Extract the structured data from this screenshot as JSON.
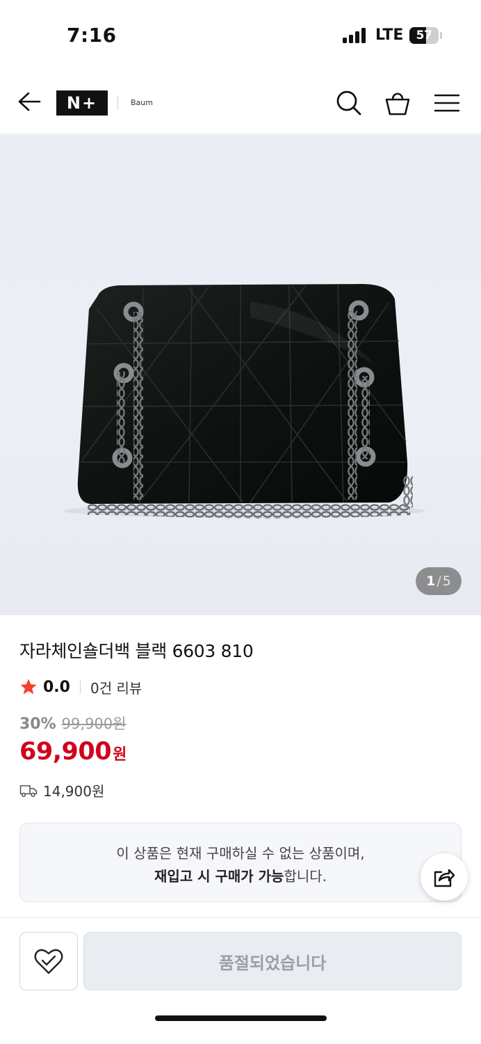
{
  "status_bar": {
    "time": "7:16",
    "network": "LTE",
    "battery_level": "57",
    "battery_fraction": 0.57
  },
  "header": {
    "back_icon": "arrow-left-icon",
    "logo_text": "N+",
    "brand_subtitle": "Baum",
    "search_icon": "search-icon",
    "bag_icon": "shopping-bag-icon",
    "menu_icon": "hamburger-menu-icon"
  },
  "gallery": {
    "current": "1",
    "separator": "/",
    "total": "5"
  },
  "product": {
    "title": "자라체인숄더백 블랙 6603 810",
    "rating_score": "0.0",
    "review_count": "0건 리뷰",
    "discount_rate": "30%",
    "original_price": "99,900원",
    "sale_price": "69,900",
    "sale_price_unit": "원",
    "shipping_fee": "14,900원"
  },
  "notice": {
    "line1": "이 상품은 현재 구매하실 수 없는 상품이며,",
    "line2_bold": "재입고 시 구매가 가능",
    "line2_rest": "합니다."
  },
  "bottom_bar": {
    "wish_icon": "heart-check-icon",
    "soldout_label": "품절되었습니다"
  },
  "colors": {
    "accent_red": "#d0021b",
    "star_red": "#f5402c",
    "text_primary": "#111111",
    "notice_bg": "#f5f7fb"
  }
}
